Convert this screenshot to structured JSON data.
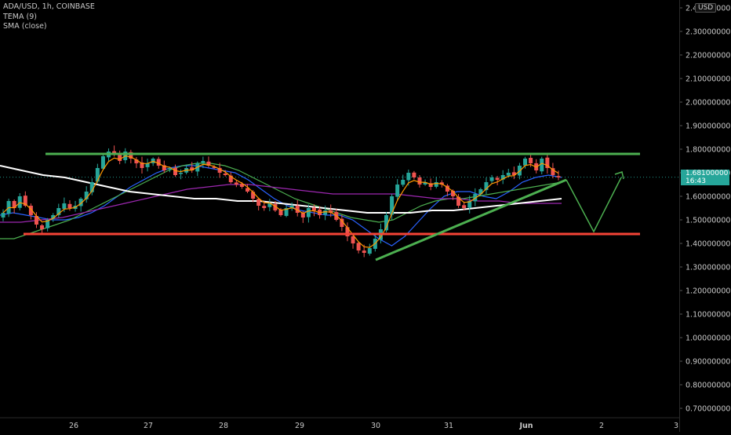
{
  "legend": {
    "symbol": "ADA/USD, 1h, COINBASE",
    "indicator_1": "TEMA (9)",
    "indicator_2": "SMA (close)"
  },
  "axis": {
    "currency": "USD",
    "last_price": "1.68100000",
    "countdown": "16:43"
  },
  "chart_data": {
    "type": "candlestick",
    "title": "ADA/USD, 1h, COINBASE",
    "x_ticks": [
      "26",
      "27",
      "28",
      "29",
      "30",
      "31",
      "Jun",
      "2",
      "3"
    ],
    "y_ticks": [
      "0.70000000",
      "0.80000000",
      "0.90000000",
      "1.00000000",
      "1.10000000",
      "1.20000000",
      "1.30000000",
      "1.40000000",
      "1.50000000",
      "1.60000000",
      "1.70000000",
      "1.80000000",
      "1.90000000",
      "2.00000000",
      "2.10000000",
      "2.20000000",
      "2.30000000",
      "2.40000000"
    ],
    "ylim": [
      0.7,
      2.4
    ],
    "grid": false,
    "candle_up_color": "#26a69a",
    "candle_down_color": "#ef5350",
    "close_price_path": [
      1.53,
      1.58,
      1.55,
      1.6,
      1.56,
      1.52,
      1.48,
      1.46,
      1.5,
      1.52,
      1.55,
      1.57,
      1.55,
      1.56,
      1.59,
      1.62,
      1.66,
      1.72,
      1.77,
      1.79,
      1.78,
      1.75,
      1.79,
      1.76,
      1.74,
      1.72,
      1.74,
      1.76,
      1.73,
      1.71,
      1.72,
      1.69,
      1.7,
      1.72,
      1.71,
      1.74,
      1.75,
      1.73,
      1.72,
      1.7,
      1.69,
      1.66,
      1.65,
      1.64,
      1.62,
      1.59,
      1.56,
      1.55,
      1.57,
      1.54,
      1.52,
      1.55,
      1.56,
      1.53,
      1.51,
      1.55,
      1.54,
      1.52,
      1.54,
      1.53,
      1.5,
      1.47,
      1.43,
      1.4,
      1.37,
      1.36,
      1.38,
      1.42,
      1.46,
      1.52,
      1.6,
      1.65,
      1.67,
      1.7,
      1.68,
      1.65,
      1.66,
      1.64,
      1.66,
      1.65,
      1.62,
      1.6,
      1.56,
      1.55,
      1.58,
      1.61,
      1.63,
      1.66,
      1.68,
      1.67,
      1.69,
      1.7,
      1.69,
      1.73,
      1.76,
      1.74,
      1.71,
      1.76,
      1.72,
      1.69,
      1.68
    ],
    "indicators": [
      {
        "name": "TEMA (9)",
        "color": "#ff9800"
      },
      {
        "name": "SMA (close)",
        "color": "#ffffff"
      }
    ],
    "moving_averages": [
      {
        "color": "#2962ff",
        "values": [
          1.52,
          1.53,
          1.52,
          1.51,
          1.5,
          1.5,
          1.51,
          1.53,
          1.56,
          1.6,
          1.64,
          1.67,
          1.7,
          1.72,
          1.73,
          1.73,
          1.72,
          1.71,
          1.7,
          1.67,
          1.63,
          1.59,
          1.56,
          1.54,
          1.53,
          1.52,
          1.52,
          1.5,
          1.46,
          1.42,
          1.39,
          1.43,
          1.49,
          1.55,
          1.6,
          1.62,
          1.62,
          1.6,
          1.59,
          1.62,
          1.66,
          1.68,
          1.69,
          1.68
        ]
      },
      {
        "color": "#4caf50",
        "values": [
          1.42,
          1.42,
          1.44,
          1.46,
          1.48,
          1.5,
          1.53,
          1.56,
          1.59,
          1.62,
          1.65,
          1.68,
          1.71,
          1.73,
          1.74,
          1.74,
          1.73,
          1.71,
          1.68,
          1.65,
          1.62,
          1.59,
          1.57,
          1.55,
          1.53,
          1.51,
          1.5,
          1.49,
          1.5,
          1.53,
          1.56,
          1.58,
          1.59,
          1.59,
          1.6,
          1.61,
          1.62,
          1.63,
          1.64,
          1.65,
          1.66
        ]
      },
      {
        "color": "#9c27b0",
        "values": [
          1.49,
          1.49,
          1.5,
          1.51,
          1.53,
          1.55,
          1.57,
          1.59,
          1.61,
          1.63,
          1.64,
          1.65,
          1.65,
          1.64,
          1.63,
          1.62,
          1.61,
          1.61,
          1.61,
          1.61,
          1.6,
          1.59,
          1.59,
          1.58,
          1.58,
          1.57,
          1.57,
          1.57
        ]
      },
      {
        "color": "#ffffff",
        "values": [
          1.73,
          1.71,
          1.69,
          1.68,
          1.66,
          1.64,
          1.62,
          1.61,
          1.6,
          1.59,
          1.59,
          1.58,
          1.58,
          1.57,
          1.56,
          1.55,
          1.54,
          1.53,
          1.53,
          1.53,
          1.54,
          1.54,
          1.55,
          1.56,
          1.57,
          1.58,
          1.59
        ]
      }
    ],
    "annotations": [
      {
        "type": "hline",
        "color": "#4caf50",
        "y": 1.78,
        "x_start": "25",
        "x_end": "Jun"
      },
      {
        "type": "hline",
        "color": "#f44336",
        "y": 1.44,
        "x_start": "25",
        "x_end": "Jun"
      },
      {
        "type": "trendline",
        "color": "#4caf50",
        "from": {
          "x": "30",
          "y": 1.33
        },
        "to": {
          "x": "Jun",
          "y": 1.67
        }
      },
      {
        "type": "projection",
        "color": "#4caf50",
        "points": [
          {
            "x": "Jun",
            "y": 1.67
          },
          {
            "x": "2",
            "y": 1.45
          },
          {
            "x": "2",
            "y": 1.68
          }
        ]
      }
    ]
  }
}
